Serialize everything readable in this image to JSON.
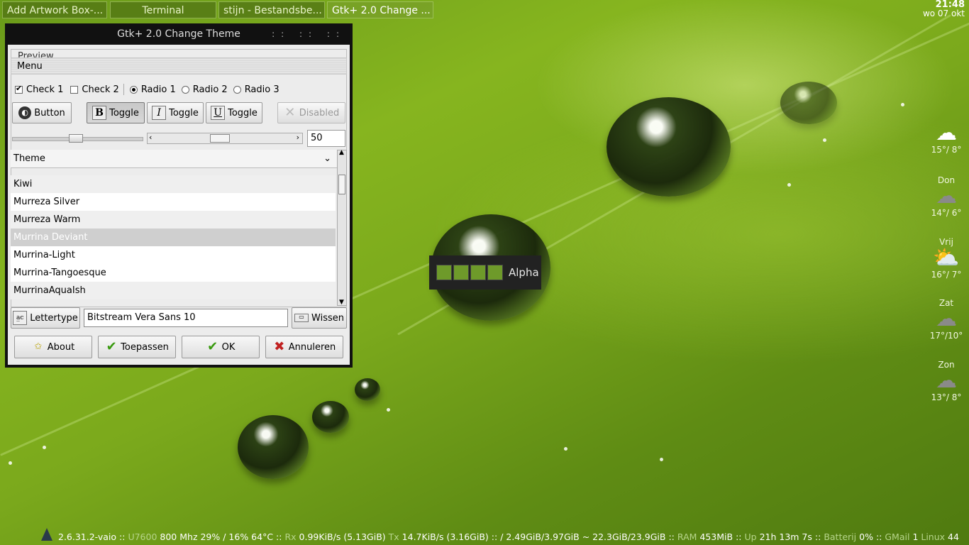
{
  "taskbar": {
    "tasks": [
      {
        "label": "Add Artwork Box-..."
      },
      {
        "label": "Terminal"
      },
      {
        "label": "stijn - Bestandsbe..."
      },
      {
        "label": "Gtk+ 2.0 Change ..."
      }
    ],
    "clock_time": "21:48",
    "clock_date": "wo 07 okt"
  },
  "window": {
    "title": "Gtk+ 2.0 Change Theme",
    "buttons": ":: :: ::",
    "preview_label": "Preview",
    "menu_label": "Menu",
    "checks": [
      "Check 1",
      "Check 2"
    ],
    "radios": [
      "Radio 1",
      "Radio 2",
      "Radio 3"
    ],
    "button_label": "Button",
    "toggle_b": "Toggle",
    "toggle_i": "Toggle",
    "toggle_u": "Toggle",
    "disabled_label": "Disabled",
    "spin_value": "50",
    "theme_header": "Theme",
    "themes": [
      "Kiwi",
      "Murreza Silver",
      "Murreza Warm",
      "Murrina Deviant",
      "Murrina-Light",
      "Murrina-Tangoesque",
      "MurrinaAquaIsh"
    ],
    "selected_theme": "Murrina Deviant",
    "font_button": "Lettertype",
    "font_value": "Bitstream Vera Sans 10",
    "clear_button": "Wissen",
    "about_button": "About",
    "apply_button": "Toepassen",
    "ok_button": "OK",
    "cancel_button": "Annuleren"
  },
  "alpha_label": "Alpha",
  "weather": [
    {
      "day": "",
      "temp": "15°/ 8°",
      "icon": "cloud-icon"
    },
    {
      "day": "Don",
      "temp": "14°/ 6°",
      "icon": "rain-icon"
    },
    {
      "day": "Vrij",
      "temp": "16°/ 7°",
      "icon": "sun-cloud-icon"
    },
    {
      "day": "Zat",
      "temp": "17°/10°",
      "icon": "rain-icon"
    },
    {
      "day": "Zon",
      "temp": "13°/ 8°",
      "icon": "rain-icon"
    }
  ],
  "status": {
    "kernel": "2.6.31.2-vaio",
    "cpu_label": "U7600",
    "cpu": "800 Mhz 29% / 16% 64°C",
    "rx_label": "Rx",
    "rx": "0.99KiB/s (5.13GiB)",
    "tx_label": "Tx",
    "tx": "14.7KiB/s (3.16GiB)",
    "disk": "/ 2.49GiB/3.97GiB ~ 22.3GiB/23.9GiB",
    "ram_label": "RAM",
    "ram": "453MiB",
    "up_label": "Up",
    "up": "21h 13m 7s",
    "bat_label": "Batterij",
    "bat": "0%",
    "gmail_label": "GMail",
    "gmail": "1",
    "linux_label": "Linux",
    "linux": "44",
    "sep": "::"
  }
}
